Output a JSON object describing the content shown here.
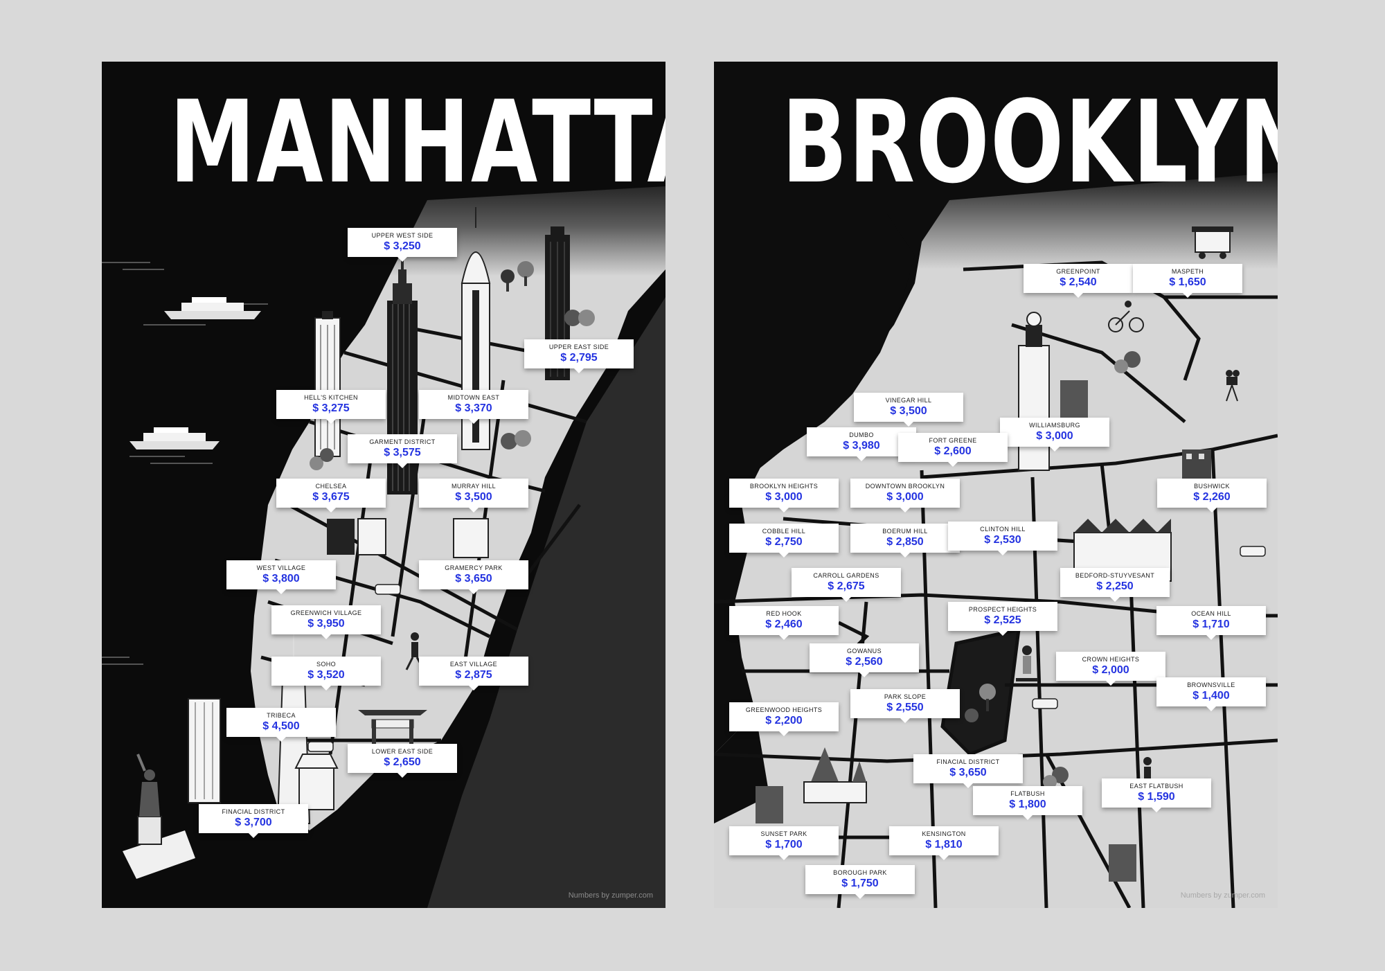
{
  "colors": {
    "page_background": "#d9d9d9",
    "poster_background": "#0b0b0b",
    "land": "#d6d6d6",
    "roads": "#111111",
    "price_text": "#2433e0"
  },
  "manhattan": {
    "title": "MANHATTAN",
    "credit": "Numbers by zumper.com",
    "neighborhoods": [
      {
        "name": "UPPER WEST SIDE",
        "price": "$ 3,250"
      },
      {
        "name": "UPPER EAST SIDE",
        "price": "$ 2,795"
      },
      {
        "name": "HELL'S KITCHEN",
        "price": "$ 3,275"
      },
      {
        "name": "MIDTOWN EAST",
        "price": "$ 3,370"
      },
      {
        "name": "GARMENT DISTRICT",
        "price": "$ 3,575"
      },
      {
        "name": "CHELSEA",
        "price": "$ 3,675"
      },
      {
        "name": "MURRAY HILL",
        "price": "$ 3,500"
      },
      {
        "name": "WEST VILLAGE",
        "price": "$ 3,800"
      },
      {
        "name": "GRAMERCY PARK",
        "price": "$ 3,650"
      },
      {
        "name": "GREENWICH VILLAGE",
        "price": "$ 3,950"
      },
      {
        "name": "SOHO",
        "price": "$ 3,520"
      },
      {
        "name": "EAST VILLAGE",
        "price": "$ 2,875"
      },
      {
        "name": "TRIBECA",
        "price": "$ 4,500"
      },
      {
        "name": "LOWER EAST SIDE",
        "price": "$ 2,650"
      },
      {
        "name": "FINACIAL DISTRICT",
        "price": "$ 3,700"
      }
    ],
    "icons": [
      "empire-state-building-icon",
      "chrysler-building-icon",
      "one-world-trade-center-icon",
      "statue-of-liberty-icon",
      "ferry-icon",
      "taxi-icon",
      "chinatown-gate-icon",
      "tree-icon",
      "walking-person-icon"
    ]
  },
  "brooklyn": {
    "title": "BROOKLYN",
    "credit": "Numbers by zumper.com",
    "neighborhoods": [
      {
        "name": "GREENPOINT",
        "price": "$ 2,540"
      },
      {
        "name": "MASPETH",
        "price": "$ 1,650"
      },
      {
        "name": "VINEGAR HILL",
        "price": "$ 3,500"
      },
      {
        "name": "WILLIAMSBURG",
        "price": "$ 3,000"
      },
      {
        "name": "DUMBO",
        "price": "$ 3,980"
      },
      {
        "name": "FORT GREENE",
        "price": "$ 2,600"
      },
      {
        "name": "BROOKLYN HEIGHTS",
        "price": "$ 3,000"
      },
      {
        "name": "DOWNTOWN BROOKLYN",
        "price": "$ 3,000"
      },
      {
        "name": "BUSHWICK",
        "price": "$ 2,260"
      },
      {
        "name": "COBBLE HILL",
        "price": "$ 2,750"
      },
      {
        "name": "BOERUM HILL",
        "price": "$ 2,850"
      },
      {
        "name": "CLINTON HILL",
        "price": "$ 2,530"
      },
      {
        "name": "CARROLL GARDENS",
        "price": "$ 2,675"
      },
      {
        "name": "BEDFORD-STUYVESANT",
        "price": "$ 2,250"
      },
      {
        "name": "RED HOOK",
        "price": "$ 2,460"
      },
      {
        "name": "PROSPECT HEIGHTS",
        "price": "$ 2,525"
      },
      {
        "name": "OCEAN HILL",
        "price": "$ 1,710"
      },
      {
        "name": "GOWANUS",
        "price": "$ 2,560"
      },
      {
        "name": "CROWN HEIGHTS",
        "price": "$ 2,000"
      },
      {
        "name": "BROWNSVILLE",
        "price": "$ 1,400"
      },
      {
        "name": "PARK SLOPE",
        "price": "$ 2,550"
      },
      {
        "name": "GREENWOOD HEIGHTS",
        "price": "$ 2,200"
      },
      {
        "name": "FINACIAL DISTRICT",
        "price": "$ 3,650"
      },
      {
        "name": "FLATBUSH",
        "price": "$ 1,800"
      },
      {
        "name": "EAST FLATBUSH",
        "price": "$ 1,590"
      },
      {
        "name": "SUNSET PARK",
        "price": "$ 1,700"
      },
      {
        "name": "KENSINGTON",
        "price": "$ 1,810"
      },
      {
        "name": "BOROUGH PARK",
        "price": "$ 1,750"
      }
    ],
    "icons": [
      "food-cart-icon",
      "cyclist-icon",
      "clock-tower-icon",
      "brownstone-icon",
      "church-icon",
      "film-camera-icon",
      "skateboarder-icon",
      "dog-walker-icon",
      "tree-icon",
      "car-icon"
    ]
  }
}
